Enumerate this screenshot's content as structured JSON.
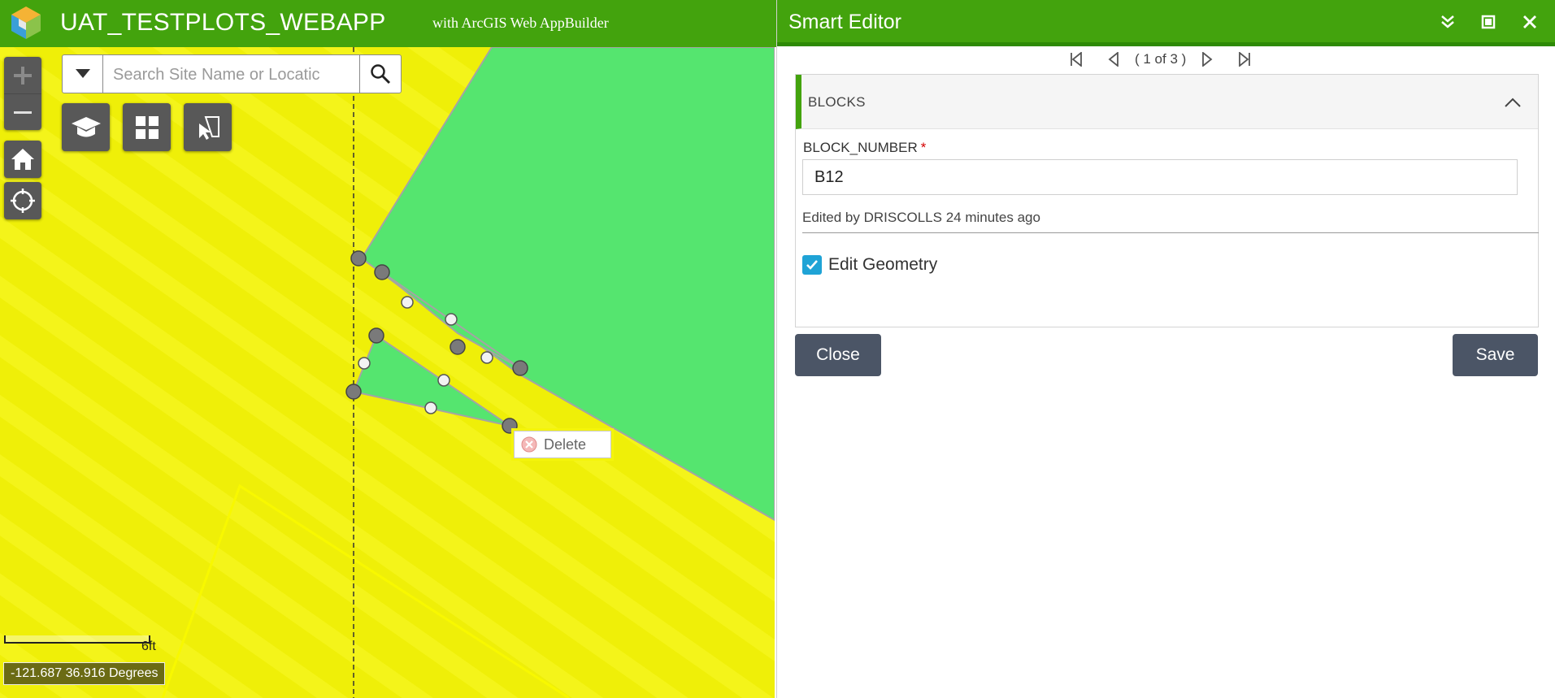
{
  "header": {
    "title": "UAT_TESTPLOTS_WEBAPP",
    "subtitle": "with ArcGIS Web AppBuilder"
  },
  "map": {
    "search": {
      "placeholder": "Search Site Name or Locatic"
    },
    "context_popup": {
      "delete_label": "Delete"
    },
    "scalebar_label": "6ft",
    "coordinates": "-121.687 36.916 Degrees",
    "colors": {
      "background": "#efef08",
      "polygon_fill": "#55e56f",
      "vertex": "#7a7a7a"
    }
  },
  "editor": {
    "title": "Smart Editor",
    "pager": {
      "text": "( 1 of 3 )"
    },
    "layer": {
      "name": "BLOCKS"
    },
    "field": {
      "label": "BLOCK_NUMBER",
      "required_mark": "*",
      "value": "B12"
    },
    "edited_by": "Edited by DRISCOLLS 24 minutes ago",
    "edit_geometry": {
      "label": "Edit Geometry",
      "checked": true
    },
    "buttons": {
      "close": "Close",
      "save": "Save"
    },
    "colors": {
      "header": "#43a30d",
      "button": "#4b5566",
      "checkbox": "#1fa3d6"
    }
  }
}
